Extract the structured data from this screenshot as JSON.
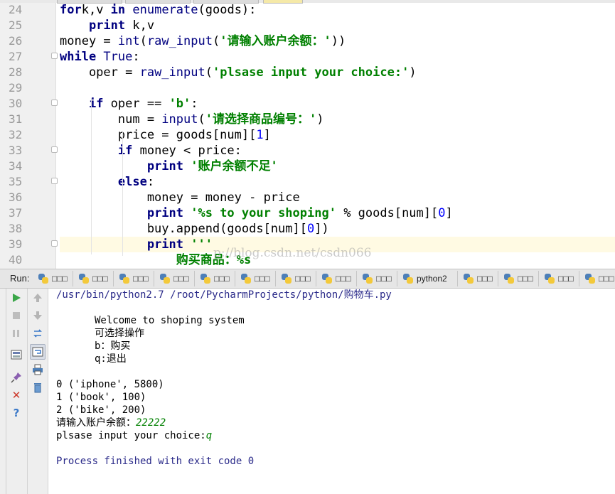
{
  "editor": {
    "lines": [
      {
        "n": "24",
        "t": [
          [
            "kw",
            "for"
          ],
          [
            "",
            "k,v "
          ],
          [
            "kw",
            "in"
          ],
          [
            "",
            ""
          ],
          [
            "bi",
            " enumerate"
          ],
          [
            "",
            "(goods):"
          ]
        ]
      },
      {
        "n": "25",
        "t": [
          [
            "",
            "    "
          ],
          [
            "kw",
            "print"
          ],
          [
            "",
            ""
          ],
          [
            "",
            " k,v"
          ]
        ]
      },
      {
        "n": "26",
        "t": [
          [
            "",
            "money = "
          ],
          [
            "bi",
            "int"
          ],
          [
            "",
            "("
          ],
          [
            "bi",
            "raw_input"
          ],
          [
            "",
            "("
          ],
          [
            "str",
            "'请输入账户余额：'"
          ],
          [
            "",
            "))"
          ]
        ]
      },
      {
        "n": "27",
        "t": [
          [
            "kw",
            "while"
          ],
          [
            "",
            ""
          ],
          [
            "bi",
            " True"
          ],
          [
            "",
            ":"
          ]
        ]
      },
      {
        "n": "28",
        "t": [
          [
            "",
            "    oper = "
          ],
          [
            "bi",
            "raw_input"
          ],
          [
            "",
            "("
          ],
          [
            "str",
            "'plsase input your choice:'"
          ],
          [
            "",
            ")"
          ]
        ]
      },
      {
        "n": "29",
        "t": [
          [
            "",
            ""
          ]
        ]
      },
      {
        "n": "30",
        "t": [
          [
            "",
            "    "
          ],
          [
            "kw",
            "if"
          ],
          [
            "",
            ""
          ],
          [
            "",
            " oper == "
          ],
          [
            "str",
            "'b'"
          ],
          [
            "",
            ":"
          ]
        ]
      },
      {
        "n": "31",
        "t": [
          [
            "",
            "        num = "
          ],
          [
            "bi",
            "input"
          ],
          [
            "",
            "("
          ],
          [
            "str",
            "'请选择商品编号：'"
          ],
          [
            "",
            ")"
          ]
        ]
      },
      {
        "n": "32",
        "t": [
          [
            "",
            "        price = goods[num]["
          ],
          [
            "num",
            "1"
          ],
          [
            "",
            "]"
          ]
        ]
      },
      {
        "n": "33",
        "t": [
          [
            "",
            "        "
          ],
          [
            "kw",
            "if"
          ],
          [
            "",
            ""
          ],
          [
            "",
            " money < price:"
          ]
        ]
      },
      {
        "n": "34",
        "t": [
          [
            "",
            "            "
          ],
          [
            "kw",
            "print"
          ],
          [
            "",
            ""
          ],
          [
            "str",
            " '账户余额不足'"
          ]
        ]
      },
      {
        "n": "35",
        "t": [
          [
            "",
            "        "
          ],
          [
            "kw",
            "else"
          ],
          [
            "",
            ":"
          ]
        ]
      },
      {
        "n": "36",
        "t": [
          [
            "",
            "            money = money - price"
          ]
        ]
      },
      {
        "n": "37",
        "t": [
          [
            "",
            "            "
          ],
          [
            "kw",
            "print"
          ],
          [
            "",
            ""
          ],
          [
            "str",
            " '%s to your shoping'"
          ],
          [
            "",
            " % goods[num]["
          ],
          [
            "num",
            "0"
          ],
          [
            "",
            "]"
          ]
        ]
      },
      {
        "n": "38",
        "t": [
          [
            "",
            "            buy.append(goods[num]["
          ],
          [
            "num",
            "0"
          ],
          [
            "",
            "])"
          ]
        ]
      },
      {
        "n": "39",
        "t": [
          [
            "",
            "            "
          ],
          [
            "kw",
            "print"
          ],
          [
            "",
            ""
          ],
          [
            "str",
            " '''"
          ]
        ]
      },
      {
        "n": "40",
        "t": [
          [
            "",
            "                "
          ],
          [
            "str",
            "购买商品：%s"
          ]
        ]
      }
    ],
    "watermark": "p://blog.csdn.net/csdn066"
  },
  "run": {
    "label": "Run:",
    "tabs": [
      "□□□",
      "□□□",
      "□□□",
      "□□□",
      "□□□",
      "□□□",
      "□□□",
      "□□□",
      "□□□",
      "python2",
      "□□□",
      "□□□",
      "□□□",
      "□□□"
    ]
  },
  "console": {
    "path": "/usr/bin/python2.7 /root/PycharmProjects/python/购物车.py",
    "welcome": "Welcome to shoping system",
    "ops_title": "可选择操作",
    "op_b": "b：购买",
    "op_q": "q:退出",
    "items": [
      "0 ('iphone', 5800)",
      "1 ('book', 100)",
      "2 ('bike', 200)"
    ],
    "balance_prompt": "请输入账户余额：",
    "balance_value": "22222",
    "choice_prompt": "plsase input your choice:",
    "choice_value": "q",
    "process": "Process finished with exit code 0"
  },
  "colors": {
    "keyword": "#000080",
    "string": "#008000",
    "number": "#0000ff",
    "run_green": "#3aa648",
    "stop_red": "#cc3a2c"
  }
}
